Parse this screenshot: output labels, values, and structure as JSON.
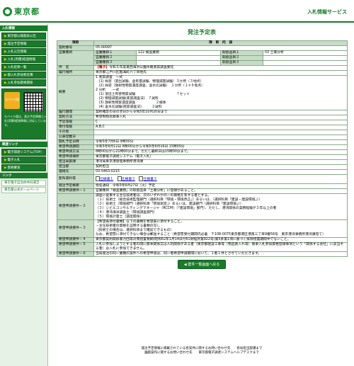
{
  "header": {
    "logo_text": "東京都",
    "service_name": "入札情報サービス"
  },
  "sidebar": {
    "section1": "入札情報",
    "items": [
      {
        "label": "東京都公報発表公告"
      },
      {
        "label": "発注予定情報"
      },
      {
        "label": "入札公告情報"
      },
      {
        "label": "入札(見積)経過情報"
      },
      {
        "label": "入札結果一覧"
      },
      {
        "label": "都入札参加者名簿"
      },
      {
        "label": "入札参加資格関係"
      }
    ],
    "mobile": {
      "label": "モバイル版",
      "text": "モバイル版は、発注予定情報と入札(見積)経過情報に対応しています。"
    },
    "section2": "関連リンク",
    "links": [
      {
        "label": "電子調達システム(TOP)"
      },
      {
        "label": "電子入札"
      },
      {
        "label": "資格審査"
      }
    ],
    "section3": "リンク",
    "sublinks": [
      {
        "label": "東京電子自治体共同運営"
      },
      {
        "label": "東京都公式ホームページ"
      }
    ]
  },
  "main": {
    "title": "発注予定表",
    "col_item": "項目",
    "col_content": "項　目　内　容",
    "rows": {
      "contract_no_label": "契約番号",
      "contract_no": "05-00097",
      "biz_label": "営業種目",
      "cat1_label": "営業種目１",
      "cat1_value": "122 検査業務",
      "cat2_label": "営業種目２",
      "cat2_value": "",
      "cat3_label": "営業種目３",
      "cat3_value": "",
      "sub1_label": "取扱品目１",
      "sub1_value": "03 土壌分析",
      "sub2_label": "取扱品目２",
      "sub2_value": "",
      "sub3_label": "取扱品目３",
      "sub3_value": "",
      "subject_label": "件　名",
      "subject_tag": "【電子】",
      "subject": "令和５年度葛西海浜公園水路底質調査委託",
      "location_label": "履行場所",
      "location": "東京都江戸川区臨海町六丁目地先",
      "summary_label": "概要",
      "summary": [
        "1 底質調査　一式",
        "　(1) 採泥（溶出試験、含有量試験、物理減量試験）３か所（３地点）",
        "　(2) 採泥（放射性物質濃度調査、含水比試験）　１か所（１×５地点）",
        "2 分析　　一式",
        "　(1) 溶出土有害物質試験　　　　　　　　　　　　７セット",
        "　(2) 物理減量試験(底質調査法)　７試料",
        "　(3) 放射性物質濃度調査　　　　　　２検体",
        "　(4) 含水比試験(底質調査法)　　　２試料"
      ],
      "period_label": "履行期間",
      "period": "契約確定の日の翌日から令和5年10月20日まで",
      "method_label": "契約方法",
      "method": "希望制指名競争入札",
      "grade_label": "予定等級",
      "grade": "C",
      "accept_label": "受付等級",
      "accept": "A,B,C",
      "other_label": "その他",
      "other": "",
      "pubdate_label": "公表登載日",
      "pubdate": "",
      "open_label": "開札予定日時",
      "open": "令和5年7月6日 9時30分",
      "apply_period_label": "希望申請期間",
      "apply_period": "令和5年6月12日 8時00分から令和5年6月16日 15時00分",
      "apply_method_label": "希望申請方法",
      "apply_method": "8時00分から21時00分まで。ただし最終日は15時00分まで。",
      "apply_place_label": "希望申請場所",
      "apply_place": "東京都電子調達システム（電子入札）",
      "office_label": "担当局部課",
      "office": "港湾局東京港管理事務所港湾課",
      "dept_label": "担当部",
      "dept": "契約担当",
      "contact_label": "連絡先",
      "contact": "03-5463-0215",
      "docs_label": "配布資料等",
      "docs": [
        "仕様書１",
        "仕様書２",
        "仕様書３"
      ],
      "req0_label": "発注予定概要",
      "req0": "指名通知　令和5年6月27日（火）予定",
      "req1_label": "希望申請要件－１",
      "req1": "営業種目「検査業務」の取扱品目「土壌分析」に登録があること。",
      "req2_label": "希望申請要件－２",
      "req2": [
        "調査に従事する主任技術者は、次のいずれかの一の資格を有する者とする。",
        "（１）技術士（総合技術監理部門（選択科目「環境・環境改正」）あるいは、（選択科目「建設・建設環境」））",
        "（２）技術士（環境部門（選択科目「環境測定」）あるいは、建設部門（選択科目「建設環境」））",
        "（３）シビルコンサルティングマネージャ（RCCM）（「建設環境」部門）、ただし、港湾関係の実務経験が３年以上の者",
        "（４）港湾海洋調査士（環境調査部門）",
        "（５）環境計量士（濃度関係）"
      ],
      "req3_label": "希望申請要件－３",
      "req3": [
        "【希望表添付書類】以下の書類を希望表に添付すること。",
        "・主任技術者の資格を証明する書類の写し",
        "（技術士の場合は、選択科目まで確認できるもの）",
        "なお、希望票に添付できない場合は郵送すること（希望票受付期間内必着　〒108-0075東京都港区港南三丁目9番56号　東京港湾事務所港湾課宛て）"
      ],
      "req4_label": "希望申請要件－４",
      "req4": "東京都契約関係暴力団等対策措置要綱(昭和62年1月14日付61財経庶第922号)第5条第1項に基づく排除措置期間中でないこと。",
      "req5_label": "希望申請要件－５",
      "req5": "入札に参加しようとする者の間に資本関係又は人的関係がある者（東京都建設工事等（物品買入れ等）競争入札参加資格登録事項という「関係する会社」に該当する者）は入札に参加できません。",
      "req6_label": "希望申請要件－６",
      "req6": "当局発注の同一業種の案件への希望申請は、同一者希望申請期間において、１者１件とさせていただきます。"
    },
    "back_button": "案件一覧画面へ戻る"
  },
  "footer": {
    "line1": "発注予定情報に掲載されている各案件に関するお問い合わせ先　　各局担当部課まで",
    "line2": "園庭操作に関するお問い合わせ先　　東京都電子調達システムヘルプデスクまで"
  }
}
